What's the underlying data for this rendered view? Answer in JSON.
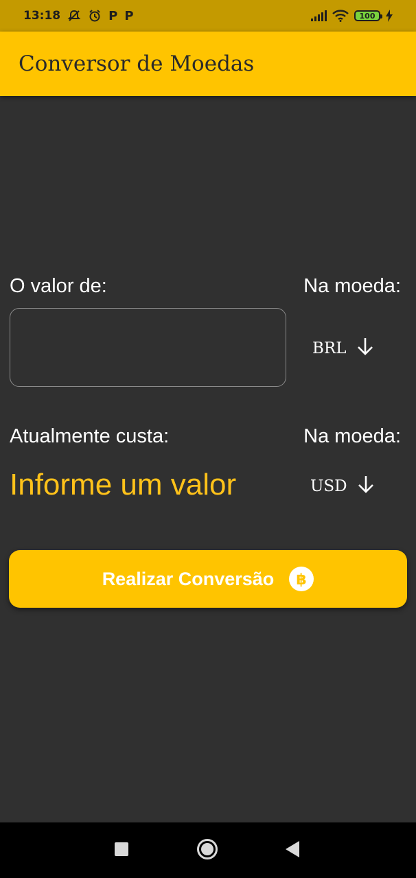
{
  "status_bar": {
    "time": "13:18",
    "battery": "100",
    "icons": [
      "silent-icon",
      "alarm-icon",
      "p-app-icon",
      "p-app-icon",
      "signal-icon",
      "wifi-icon",
      "battery-icon",
      "charging-icon"
    ],
    "p_glyph": "P"
  },
  "app_bar": {
    "title": "Conversor de Moedas"
  },
  "from": {
    "label": "O valor de:",
    "currency_label": "Na moeda:",
    "value": "",
    "currency": "BRL"
  },
  "to": {
    "label": "Atualmente custa:",
    "currency_label": "Na moeda:",
    "result": "Informe um valor",
    "currency": "USD"
  },
  "button": {
    "label": "Realizar Conversão",
    "icon": "bitcoin-icon"
  },
  "colors": {
    "accent": "#ffc400",
    "status_bar": "#c49a00",
    "background": "#303030",
    "result_text": "#ffc21a"
  }
}
